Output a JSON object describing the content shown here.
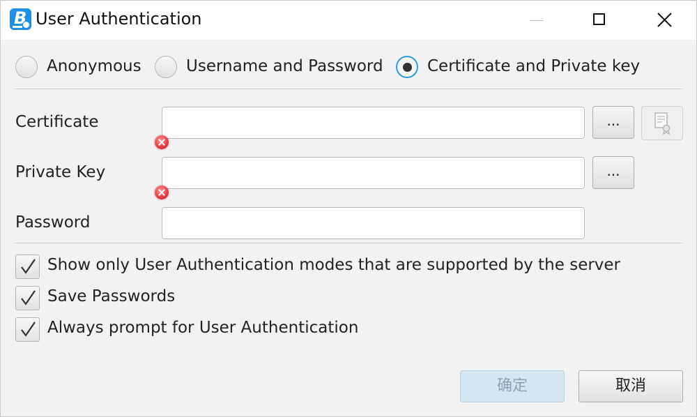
{
  "window": {
    "title": "User Authentication",
    "icon": "app-b-icon",
    "controls": {
      "minimize": "minimize-icon",
      "maximize": "maximize-icon",
      "close": "close-icon"
    }
  },
  "auth_modes": {
    "options": [
      "Anonymous",
      "Username and Password",
      "Certificate and Private key"
    ],
    "selected": "Certificate and Private key"
  },
  "fields": {
    "certificate": {
      "label": "Certificate",
      "value": "",
      "browse_label": "...",
      "has_error": true
    },
    "private_key": {
      "label": "Private Key",
      "value": "",
      "browse_label": "...",
      "has_error": true
    },
    "password": {
      "label": "Password",
      "value": ""
    }
  },
  "options": [
    {
      "label": "Show only User Authentication modes that are supported by the server",
      "checked": true
    },
    {
      "label": "Save Passwords",
      "checked": true
    },
    {
      "label": "Always prompt for User Authentication",
      "checked": true
    }
  ],
  "buttons": {
    "ok": "确定",
    "cancel": "取消"
  },
  "colors": {
    "accent": "#2e9bd8",
    "error": "#d9303a",
    "app_icon": "#1e8fe1"
  }
}
